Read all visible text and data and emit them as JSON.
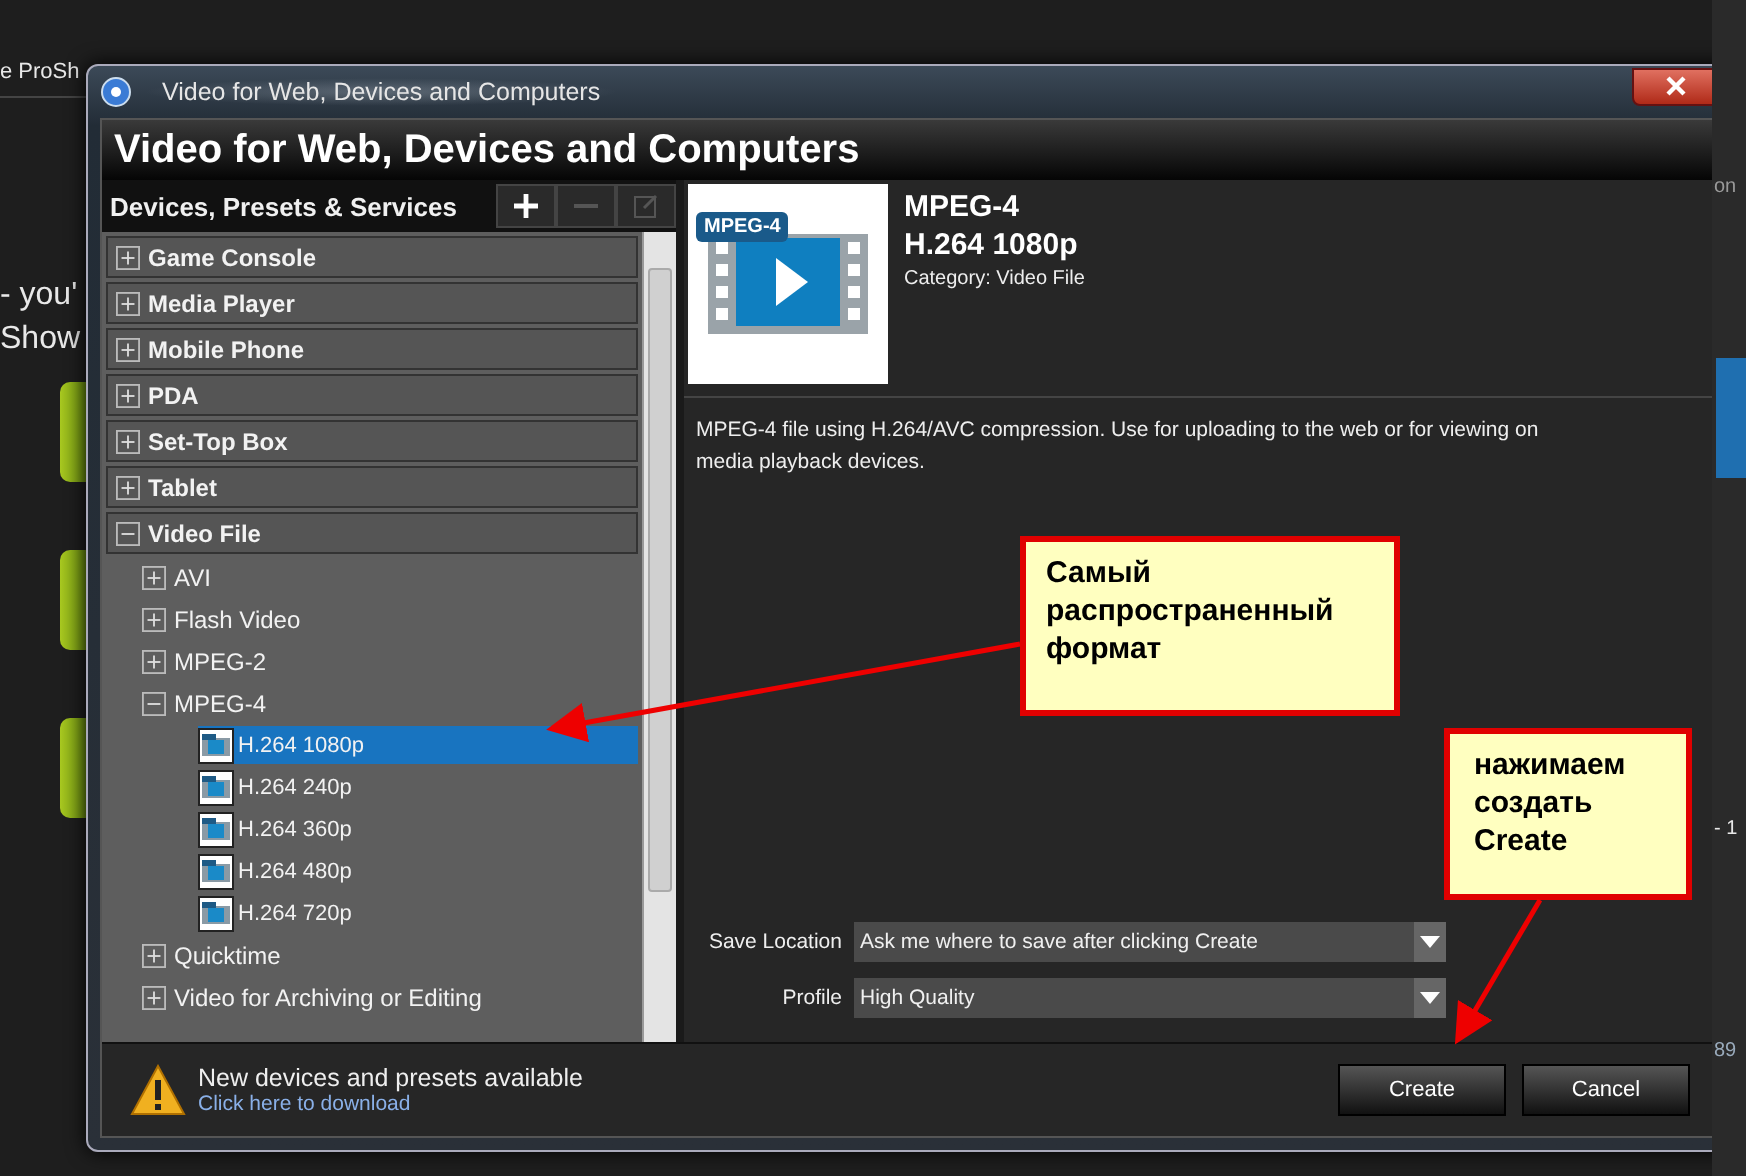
{
  "background_app": {
    "left_texts": [
      "e ProSh",
      "- you'",
      "Show"
    ],
    "right_texts": [
      "on",
      "- 1",
      "89"
    ]
  },
  "window": {
    "title": "Video for Web, Devices and Computers",
    "heading": "Video for Web, Devices and Computers"
  },
  "tree": {
    "title": "Devices, Presets & Services",
    "toolbar": [
      {
        "kind": "add",
        "disabled": false
      },
      {
        "kind": "remove",
        "disabled": true
      },
      {
        "kind": "edit",
        "disabled": true
      }
    ],
    "items": [
      {
        "label": "Game Console",
        "expanded": false
      },
      {
        "label": "Media Player",
        "expanded": false
      },
      {
        "label": "Mobile Phone",
        "expanded": false
      },
      {
        "label": "PDA",
        "expanded": false
      },
      {
        "label": "Set-Top Box",
        "expanded": false
      },
      {
        "label": "Tablet",
        "expanded": false
      },
      {
        "label": "Video File",
        "expanded": true,
        "children": [
          {
            "label": "AVI",
            "expanded": false
          },
          {
            "label": "Flash Video",
            "expanded": false
          },
          {
            "label": "MPEG-2",
            "expanded": false
          },
          {
            "label": "MPEG-4",
            "expanded": true,
            "children": [
              {
                "label": "H.264 1080p",
                "selected": true
              },
              {
                "label": "H.264 240p",
                "selected": false
              },
              {
                "label": "H.264 360p",
                "selected": false
              },
              {
                "label": "H.264 480p",
                "selected": false
              },
              {
                "label": "H.264 720p",
                "selected": false
              }
            ]
          },
          {
            "label": "Quicktime",
            "expanded": false
          },
          {
            "label": "Video for Archiving or Editing",
            "expanded": false
          }
        ]
      }
    ]
  },
  "preset": {
    "badge": "MPEG-4",
    "name": "MPEG-4",
    "variant": "H.264 1080p",
    "category": "Category: Video File",
    "description": "MPEG-4 file using H.264/AVC compression. Use for uploading to the web or for viewing on media playback devices."
  },
  "fields": [
    {
      "label": "Save Location",
      "value": "Ask me where to save after clicking Create"
    },
    {
      "label": "Profile",
      "value": "High Quality"
    }
  ],
  "notice": {
    "message": "New devices and presets available",
    "link": "Click here to download"
  },
  "buttons": [
    "Create",
    "Cancel"
  ],
  "callouts": [
    {
      "lines": [
        "Самый",
        "распространенный",
        "формат"
      ]
    },
    {
      "lines": [
        "нажимаем",
        "создать",
        "Create"
      ]
    }
  ]
}
